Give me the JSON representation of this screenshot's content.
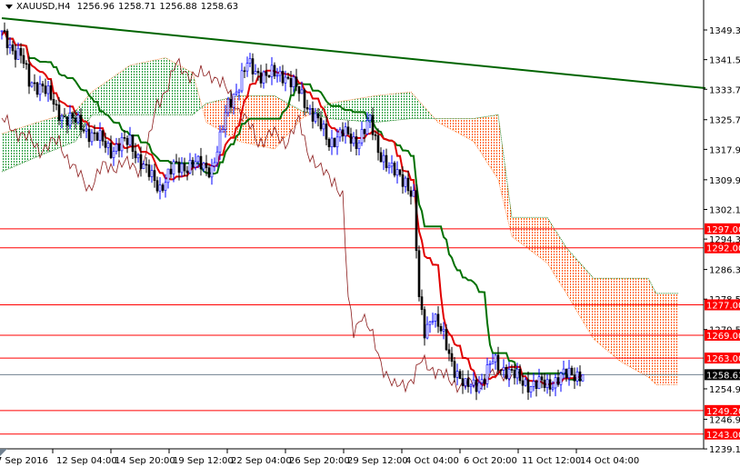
{
  "header": {
    "symbol": "XAUUSD,H4",
    "open": "1256.96",
    "high": "1258.71",
    "low": "1256.88",
    "close": "1258.63"
  },
  "colors": {
    "bull": "#0000ff",
    "bear": "#000000",
    "tenkan": "#e00000",
    "kijun": "#007000",
    "chikou": "#8b1a1a",
    "trendline": "#006400",
    "level": "#ff0000",
    "current": "#708090",
    "cloud_bear": "#ff5a00",
    "cloud_bull": "#1a9b3a"
  },
  "chart_data": {
    "type": "candlestick",
    "title": "XAUUSD,H4",
    "ylim": [
      1237,
      1355
    ],
    "y_ticks": [
      "1349.30",
      "1341.50",
      "1333.70",
      "1325.70",
      "1317.90",
      "1309.90",
      "1302.10",
      "1294.30",
      "1286.30",
      "1278.50",
      "1270.50",
      "1254.90",
      "1246.90",
      "1239.10"
    ],
    "x_ticks": [
      "7 Sep 2016",
      "12 Sep 04:00",
      "14 Sep 20:00",
      "19 Sep 12:00",
      "22 Sep 04:00",
      "26 Sep 20:00",
      "29 Sep 12:00",
      "4 Oct 04:00",
      "6 Oct 20:00",
      "11 Oct 12:00",
      "14 Oct 04:00"
    ],
    "bars_total": 214,
    "close_keypoints": [
      [
        0,
        1348
      ],
      [
        3,
        1345
      ],
      [
        7,
        1343
      ],
      [
        10,
        1335
      ],
      [
        15,
        1335
      ],
      [
        20,
        1328
      ],
      [
        27,
        1325
      ],
      [
        33,
        1322
      ],
      [
        40,
        1318
      ],
      [
        47,
        1320
      ],
      [
        53,
        1312
      ],
      [
        58,
        1308
      ],
      [
        63,
        1313
      ],
      [
        70,
        1314
      ],
      [
        77,
        1313
      ],
      [
        80,
        1320
      ],
      [
        83,
        1330
      ],
      [
        87,
        1335
      ],
      [
        90,
        1340
      ],
      [
        97,
        1337
      ],
      [
        103,
        1338
      ],
      [
        110,
        1332
      ],
      [
        115,
        1326
      ],
      [
        120,
        1320
      ],
      [
        125,
        1322
      ],
      [
        130,
        1320
      ],
      [
        135,
        1325
      ],
      [
        138,
        1318
      ],
      [
        143,
        1312
      ],
      [
        148,
        1310
      ],
      [
        151,
        1305
      ],
      [
        153,
        1278
      ],
      [
        155,
        1270
      ],
      [
        158,
        1275
      ],
      [
        162,
        1268
      ],
      [
        165,
        1262
      ],
      [
        170,
        1255
      ],
      [
        173,
        1256
      ],
      [
        177,
        1258
      ],
      [
        180,
        1262
      ],
      [
        185,
        1260
      ],
      [
        190,
        1257
      ],
      [
        195,
        1256
      ],
      [
        200,
        1256
      ],
      [
        205,
        1258
      ],
      [
        210,
        1259
      ],
      [
        213,
        1258.63
      ]
    ],
    "cloud_keypoints": [
      [
        0,
        1322,
        1312
      ],
      [
        13,
        1325,
        1316
      ],
      [
        27,
        1328,
        1320
      ],
      [
        33,
        1333,
        1327
      ],
      [
        47,
        1340,
        1327
      ],
      [
        60,
        1342,
        1327
      ],
      [
        70,
        1338,
        1327
      ],
      [
        75,
        1325,
        1330
      ],
      [
        87,
        1320,
        1332
      ],
      [
        100,
        1318,
        1332
      ],
      [
        110,
        1326,
        1328
      ],
      [
        120,
        1330,
        1326
      ],
      [
        137,
        1332,
        1325
      ],
      [
        150,
        1333,
        1326
      ],
      [
        160,
        1325,
        1326
      ],
      [
        173,
        1320,
        1326
      ],
      [
        182,
        1310,
        1327
      ],
      [
        187,
        1295,
        1300
      ],
      [
        200,
        1288,
        1300
      ],
      [
        207,
        1280,
        1292
      ],
      [
        217,
        1268,
        1284
      ],
      [
        227,
        1262,
        1284
      ],
      [
        237,
        1258,
        1284
      ],
      [
        240,
        1256,
        1280
      ],
      [
        248,
        1256,
        1280
      ]
    ],
    "levels": [
      {
        "price": 1297.0,
        "label": "1297.00"
      },
      {
        "price": 1292.0,
        "label": "1292.00"
      },
      {
        "price": 1277.0,
        "label": "1277.00"
      },
      {
        "price": 1269.0,
        "label": "1269.00"
      },
      {
        "price": 1263.0,
        "label": "1263.00"
      },
      {
        "price": 1249.2,
        "label": "1249.20"
      },
      {
        "price": 1243.0,
        "label": "1243.00"
      }
    ],
    "current_price": {
      "price": 1258.63,
      "label": "1258.63"
    },
    "trendline": {
      "start": [
        0,
        1352.4
      ],
      "end": [
        258,
        1334.0
      ]
    }
  }
}
